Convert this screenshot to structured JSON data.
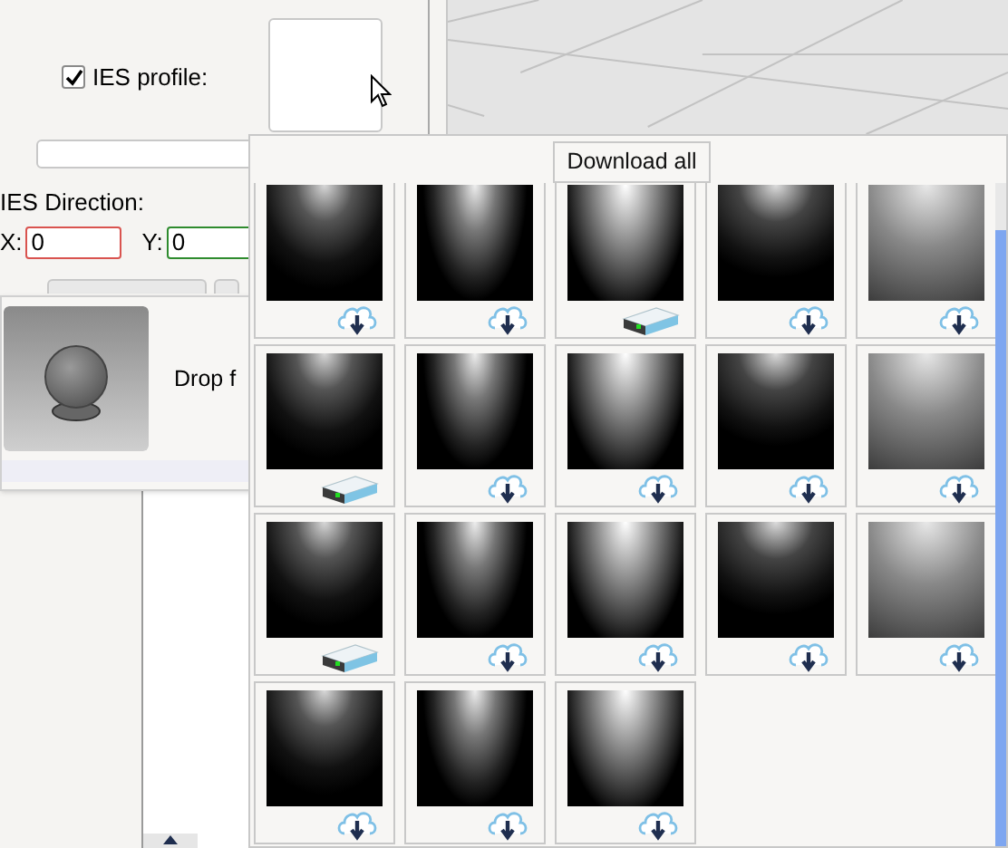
{
  "ies_profile": {
    "label": "IES profile:",
    "checked": true
  },
  "ies_direction": {
    "label": "IES Direction:",
    "x_label": "X:",
    "x_value": "0",
    "y_label": "Y:",
    "y_value": "0"
  },
  "drop_panel": {
    "text": "Drop f"
  },
  "library_popup": {
    "download_all": "Download all",
    "profiles": [
      {
        "kind": "cloud"
      },
      {
        "kind": "cloud"
      },
      {
        "kind": "local"
      },
      {
        "kind": "cloud"
      },
      {
        "kind": "cloud"
      },
      {
        "kind": "local"
      },
      {
        "kind": "cloud"
      },
      {
        "kind": "cloud"
      },
      {
        "kind": "cloud"
      },
      {
        "kind": "cloud"
      },
      {
        "kind": "local"
      },
      {
        "kind": "cloud"
      },
      {
        "kind": "cloud"
      },
      {
        "kind": "cloud"
      },
      {
        "kind": "cloud"
      },
      {
        "kind": "cloud"
      },
      {
        "kind": "cloud"
      },
      {
        "kind": "cloud"
      }
    ]
  }
}
